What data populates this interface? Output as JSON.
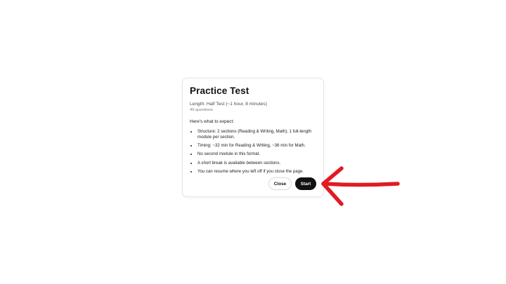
{
  "dialog": {
    "title": "Practice Test",
    "length": "Length: Half Test (~1 hour, 8 minutes)",
    "question_count": "49 questions",
    "expect_heading": "Here's what to expect:",
    "bullets": [
      "Structure: 2 sections (Reading & Writing, Math); 1 full-length module per section.",
      "Timing: ~32 min for Reading & Writing, ~36 min for Math.",
      "No second module in this format.",
      "A short break is available between sections.",
      "You can resume where you left off if you close the page."
    ],
    "close_label": "Close",
    "start_label": "Start"
  },
  "annotation": {
    "arrow_color": "#e01b24"
  },
  "colors": {
    "primary_button": "#111111",
    "page_background": "#ffffff"
  }
}
